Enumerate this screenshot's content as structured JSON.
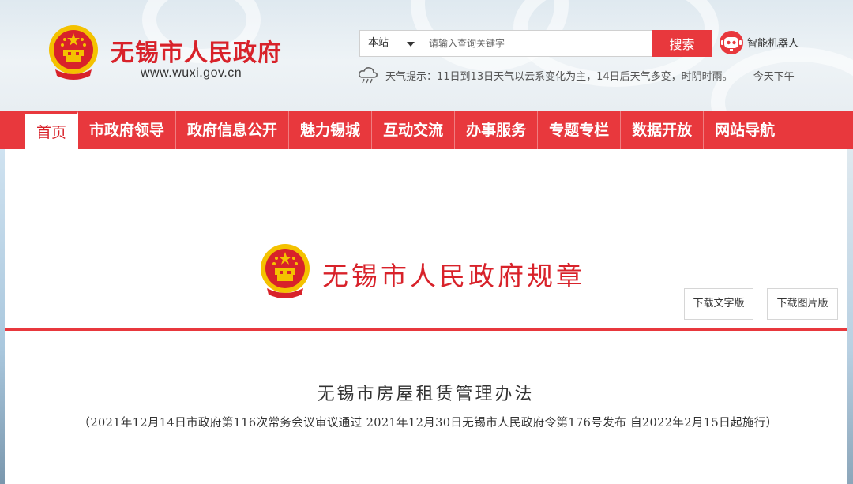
{
  "header": {
    "site_name": "无锡市人民政府",
    "site_url": "www.wuxi.gov.cn",
    "search": {
      "scope": "本站",
      "placeholder": "请输入查询关键字",
      "button": "搜索"
    },
    "robot_label": "智能机器人",
    "weather": {
      "text": "天气提示：11日到13日天气以云系变化为主，14日后天气多变，时阴时雨。",
      "extra": "今天下午"
    }
  },
  "nav": {
    "items": [
      "首页",
      "市政府领导",
      "政府信息公开",
      "魅力锡城",
      "互动交流",
      "办事服务",
      "专题专栏",
      "数据开放",
      "网站导航"
    ]
  },
  "document": {
    "banner_title": "无锡市人民政府规章",
    "download_text": "下载文字版",
    "download_image": "下载图片版",
    "title": "无锡市房屋租赁管理办法",
    "meta": "（2021年12月14日市政府第116次常务会议审议通过 2021年12月30日无锡市人民政府令第176号发布 自2022年2月15日起施行）"
  },
  "colors": {
    "brand_red": "#e8383d",
    "title_red": "#d8222a",
    "emblem_gold": "#f4c200"
  }
}
